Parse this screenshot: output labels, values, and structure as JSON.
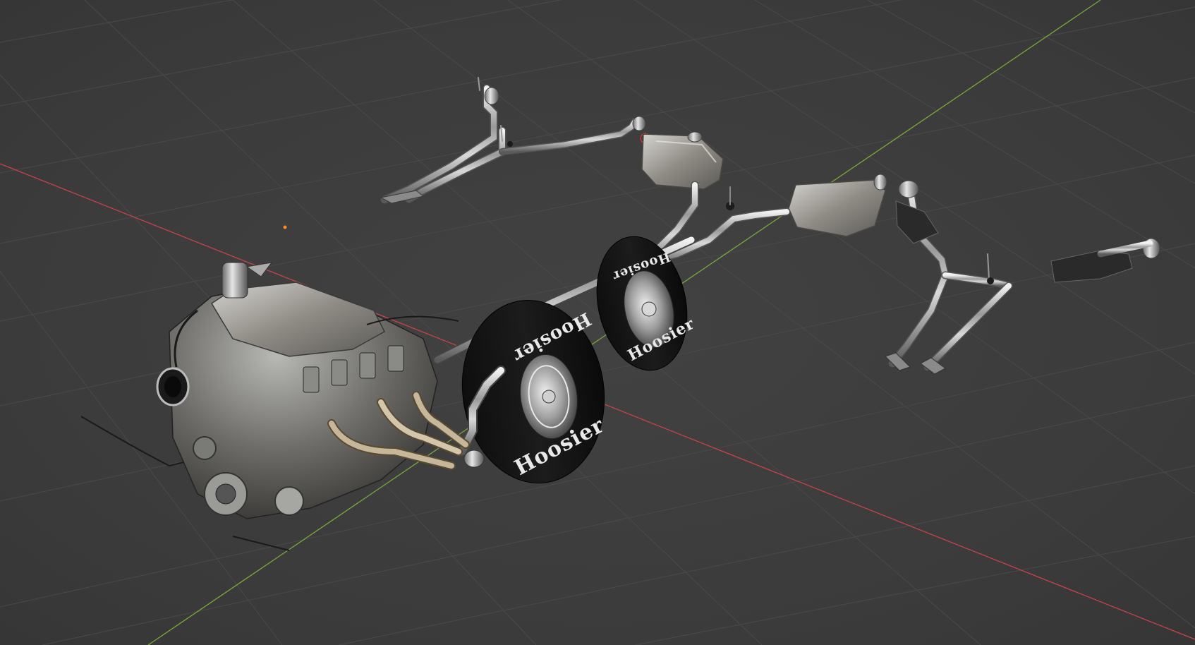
{
  "viewport": {
    "background": "#3d3d3d",
    "grid_color": "#4a4a4a",
    "x_axis_color": "#c8424a",
    "y_axis_color": "#7aa83a",
    "origin_marker_color": "#ff8a1a"
  },
  "scene": {
    "tire_brand": "Hoosier",
    "objects": [
      "engine-block",
      "intake-manifold",
      "exhaust-headers",
      "drag-wheel-front",
      "drag-wheel-rear",
      "rear-axle-tube",
      "exhaust-system-left",
      "exhaust-system-center",
      "exhaust-system-right",
      "muffler"
    ]
  }
}
